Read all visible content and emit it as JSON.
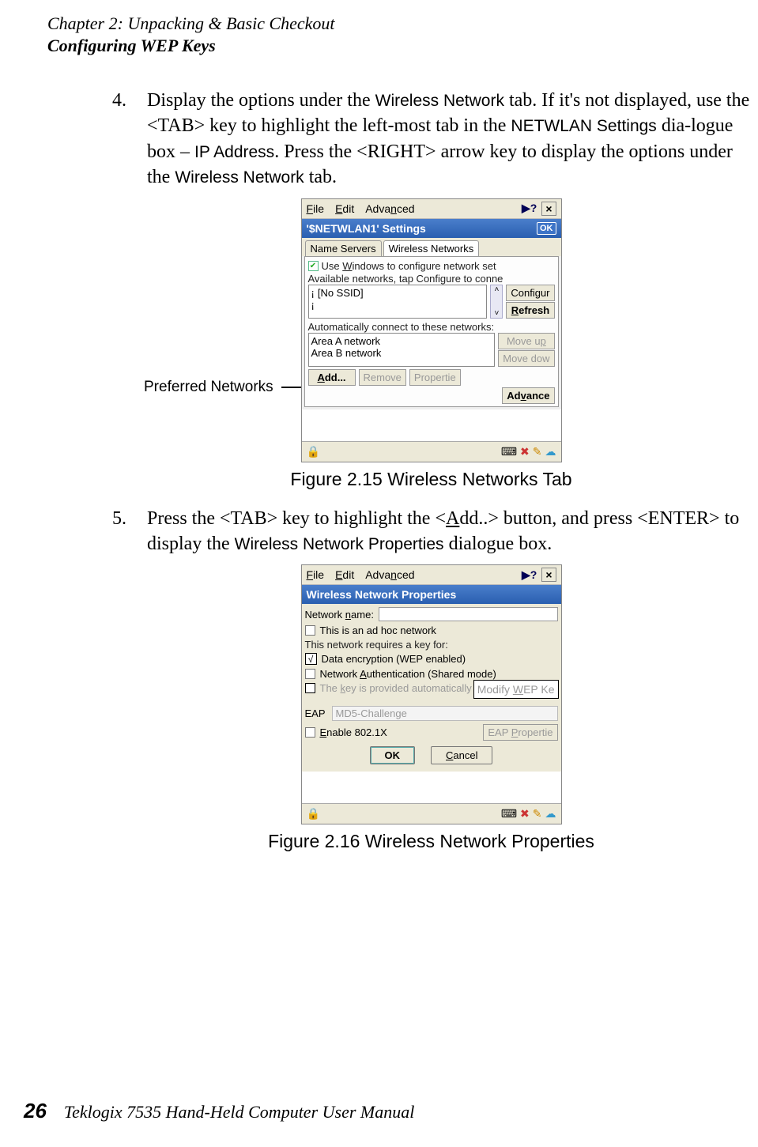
{
  "header": {
    "chapter_line": "Chapter  2:  Unpacking & Basic Checkout",
    "section_line": "Configuring WEP Keys"
  },
  "step4": {
    "num": "4.",
    "t1": "Display the options under the ",
    "wnet": "Wireless Network",
    "t2": " tab. If it's not displayed, use the <TAB> key to highlight the left-most tab in the ",
    "netwlan": "NETWLAN Settings",
    "t3": " dia-logue box – ",
    "ip": "IP Address",
    "t4": ". Press the <RIGHT> arrow key to display the options under the ",
    "t5": " tab."
  },
  "fig1": {
    "caption": "Figure 2.15 Wireless Networks Tab",
    "callout": "Preferred Networks",
    "menubar": {
      "file": "File",
      "edit": "Edit",
      "advanced": "Advanced",
      "help": "?",
      "close": "×"
    },
    "title": "'$NETWLAN1' Settings",
    "ok": "OK",
    "tabs": {
      "t1": "Name Servers",
      "t2": "Wireless Networks"
    },
    "use_windows_pre": "Use ",
    "use_windows_u": "W",
    "use_windows_post": "indows to configure network set",
    "available": "Available networks, tap Configure to conne",
    "no_ssid": "[No SSID]",
    "configure": "Configur",
    "refresh": "Refresh",
    "auto": "Automatically connect to these networks:",
    "pref": [
      "Area A network",
      "Area B network"
    ],
    "moveup": "Move up",
    "movedown": "Move dow",
    "add_u": "A",
    "add_rest": "dd...",
    "remove": "Remove",
    "properties": "Propertie",
    "advance_u": "v",
    "advance_pre": "Ad",
    "advance_post": "ance"
  },
  "step5": {
    "num": "5.",
    "t1": "Press the <TAB> key to highlight the <",
    "add_u": "A",
    "add_rest": "dd..> button, and press <ENTER> to display the ",
    "wnp": "Wireless Network Properties",
    "t3": " dialogue box."
  },
  "fig2": {
    "caption": "Figure 2.16 Wireless Network Properties",
    "menubar": {
      "file": "File",
      "edit": "Edit",
      "advanced": "Advanced",
      "help": "?",
      "close": "×"
    },
    "title": "Wireless Network Properties",
    "name_pre": "Network ",
    "name_u": "n",
    "name_post": "ame:",
    "adhoc": "This is an ad hoc network",
    "requires": "This network requires a key for:",
    "wep": "Data encryption (WEP enabled)",
    "auth_pre": "Network ",
    "auth_u": "A",
    "auth_post": "uthentication (Shared mode)",
    "provided_pre": "The ",
    "provided_u": "k",
    "provided_post": "ey is provided automatically",
    "modify_pre": "Modify ",
    "modify_u": "W",
    "modify_post": "EP Ke",
    "eap": "EAP",
    "md5": "MD5-Challenge",
    "enable_pre": "",
    "enable_u": "E",
    "enable_post": "nable 802.1X",
    "eapprop_pre": "EAP ",
    "eapprop_u": "P",
    "eapprop_post": "ropertie",
    "okbtn": "OK",
    "cancel_u": "C",
    "cancel_rest": "ancel"
  },
  "footer": {
    "page": "26",
    "text": "Teklogix 7535 Hand-Held Computer User Manual"
  },
  "sqrt": "√"
}
